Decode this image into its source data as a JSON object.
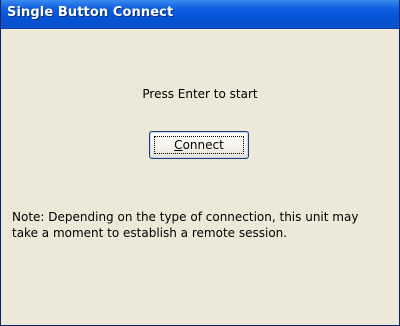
{
  "window": {
    "title": "Single Button Connect"
  },
  "main": {
    "prompt": "Press Enter to start",
    "connect_button": {
      "label": "Connect",
      "mnemonic": "C",
      "label_rest": "onnect"
    },
    "note": "Note:  Depending on the type of connection, this unit may take a moment to establish a remote session."
  },
  "colors": {
    "titlebar": "#0654d8",
    "title_text": "#ffffff",
    "client_bg": "#ece9d8"
  }
}
